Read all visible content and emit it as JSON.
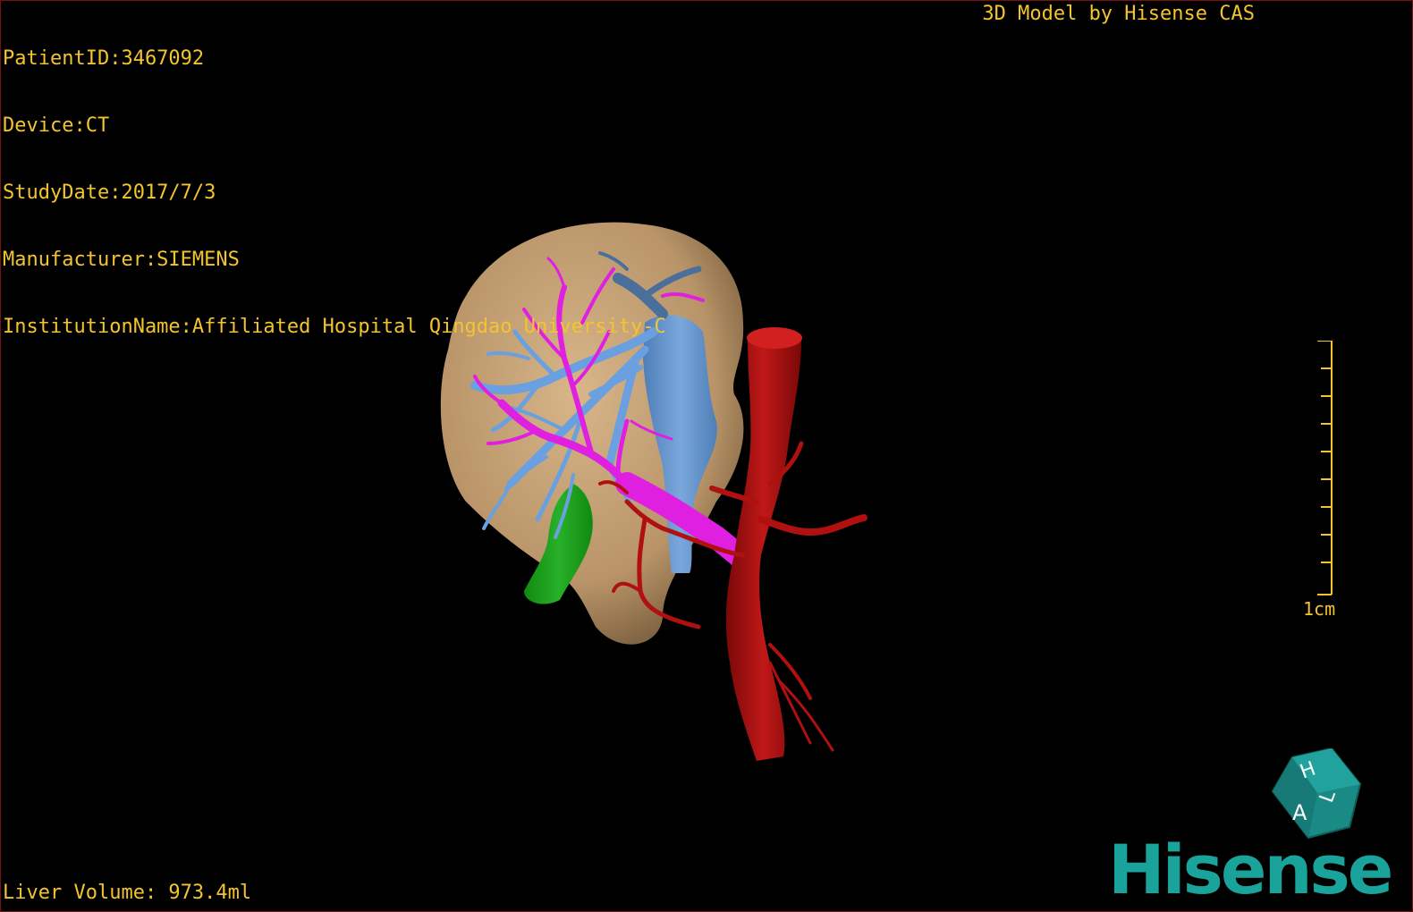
{
  "study_info": {
    "patient_id": "PatientID:3467092",
    "device": "Device:CT",
    "study_date": "StudyDate:2017/7/3",
    "manufacturer": "Manufacturer:SIEMENS",
    "institution": "InstitutionName:Affiliated Hospital Qingdao University-C"
  },
  "model_credit": "3D Model by Hisense CAS",
  "liver_volume": "Liver Volume: 973.4ml",
  "scale": {
    "label": "1cm",
    "color": "#f4c430"
  },
  "orientation_cube": {
    "letters": [
      "H",
      "A",
      "L"
    ],
    "color": "#1a8a85"
  },
  "brand": {
    "name": "Hisense",
    "color": "#1aa39a"
  },
  "colors": {
    "text": "#f4c430",
    "liver": "#c8a478",
    "hepatic_vein": "#6aa0e0",
    "portal_vein": "#e020e0",
    "artery": "#b01010",
    "biliary": "#20a020",
    "background": "#000000"
  }
}
